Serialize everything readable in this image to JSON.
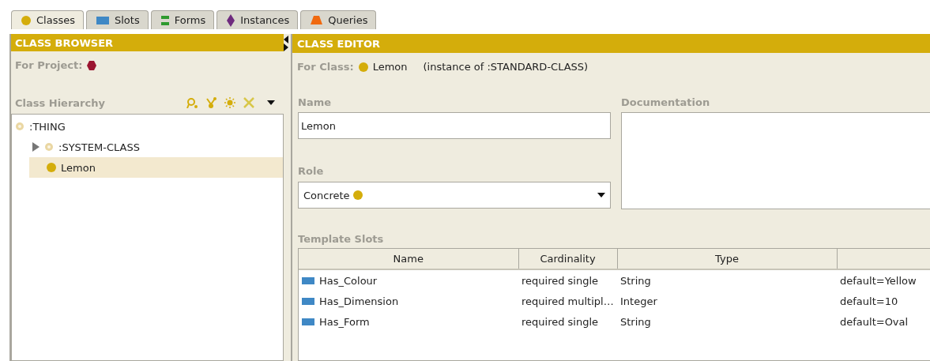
{
  "tabs": [
    {
      "label": "Classes",
      "kind": "circle",
      "color": "#d4ad0b",
      "selected": true
    },
    {
      "label": "Slots",
      "kind": "rect",
      "color": "#3f88c5",
      "selected": false
    },
    {
      "label": "Forms",
      "kind": "bars",
      "color": "#2e9a2e",
      "selected": false
    },
    {
      "label": "Instances",
      "kind": "diamond",
      "color": "#6e2a7e",
      "selected": false
    },
    {
      "label": "Queries",
      "kind": "trapezoid",
      "color": "#f0690f",
      "selected": false
    }
  ],
  "browser": {
    "title": "CLASS BROWSER",
    "project_label": "For Project:",
    "hierarchy_label": "Class Hierarchy",
    "tree": [
      {
        "label": ":THING",
        "kind": "system",
        "expandable": false,
        "selected": false,
        "children": [
          {
            "label": ":SYSTEM-CLASS",
            "kind": "system",
            "expandable": true,
            "selected": false
          },
          {
            "label": "Lemon",
            "kind": "concrete",
            "expandable": false,
            "selected": true
          }
        ]
      }
    ]
  },
  "editor": {
    "title": "CLASS EDITOR",
    "for_class_label": "For Class:",
    "class_name": "Lemon",
    "instance_of": "(instance of :STANDARD-CLASS)",
    "name_label": "Name",
    "name_value": "Lemon",
    "documentation_label": "Documentation",
    "role_label": "Role",
    "role_value": "Concrete",
    "template_slots_label": "Template Slots",
    "table": {
      "columns": [
        "Name",
        "Cardinality",
        "Type"
      ],
      "rows": [
        {
          "name": "Has_Colour",
          "cardinality": "required single",
          "type": "String",
          "column_4": "default=Yellow"
        },
        {
          "name": "Has_Dimension",
          "cardinality": "required multipl…",
          "type": "Integer",
          "column_4": "default=10"
        },
        {
          "name": "Has_Form",
          "cardinality": "required single",
          "type": "String",
          "column_4": "default=Oval"
        }
      ]
    }
  }
}
